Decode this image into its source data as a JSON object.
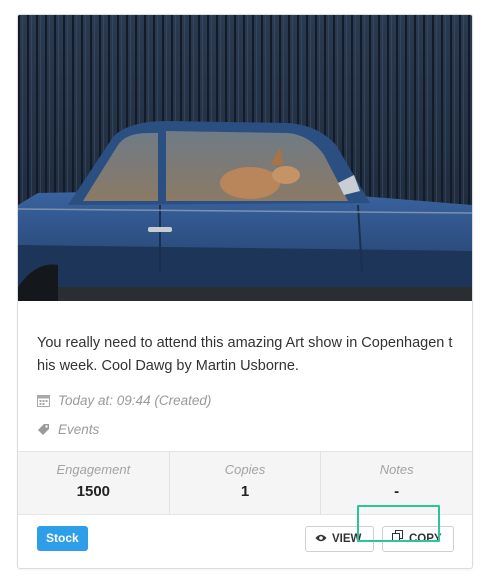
{
  "post": {
    "description": "You really need to attend this amazing Art show in Copenhagen this week. Cool Dawg by Martin Usborne.",
    "date": "Today at: 09:44 (Created)",
    "category": "Events"
  },
  "stats": [
    {
      "label": "Engagement",
      "value": "1500"
    },
    {
      "label": "Copies",
      "value": "1"
    },
    {
      "label": "Notes",
      "value": "-"
    }
  ],
  "footer": {
    "stock_label": "Stock",
    "view_label": "VIEW",
    "copy_label": "COPY"
  },
  "colors": {
    "stock_button": "#2e9ee8",
    "copy_highlight": "#2ec49a",
    "car_body": "#2b4f7f"
  },
  "icons": {
    "date": "calendar-icon",
    "category": "tag-icon",
    "view": "eye-icon",
    "copy": "copy-icon"
  }
}
